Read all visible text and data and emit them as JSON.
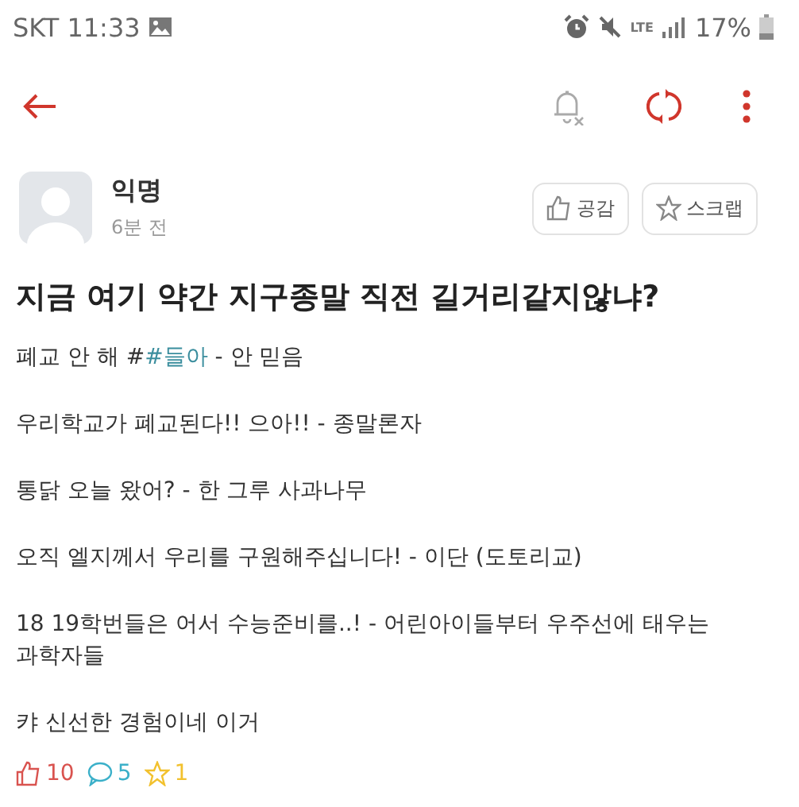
{
  "status_bar": {
    "carrier": "SKT",
    "time": "11:33",
    "network": "LTE",
    "battery": "17%"
  },
  "post": {
    "author": "익명",
    "time": "6분 전",
    "actions": [
      {
        "kind": "like",
        "label": "공감"
      },
      {
        "kind": "scrap",
        "label": "스크랩"
      }
    ],
    "title": "지금 여기 약간 지구종말 직전 길거리같지않냐?",
    "paragraphs": [
      {
        "parts": [
          {
            "kind": "text",
            "text": "폐교 안 해 #"
          },
          {
            "kind": "hashtag",
            "text": "#들아"
          },
          {
            "kind": "text",
            "text": " - 안 믿음"
          }
        ]
      },
      {
        "parts": [
          {
            "kind": "text",
            "text": "우리학교가 폐교된다!! 으아!! - 종말론자"
          }
        ]
      },
      {
        "parts": [
          {
            "kind": "text",
            "text": "통닭 오늘 왔어? - 한 그루 사과나무"
          }
        ]
      },
      {
        "parts": [
          {
            "kind": "text",
            "text": "오직 엘지께서 우리를 구원해주십니다! - 이단 (도토리교)"
          }
        ]
      },
      {
        "parts": [
          {
            "kind": "text",
            "text": "18 19학번들은 어서 수능준비를..! - 어린아이들부터 우주선에 태우는 과학자들"
          }
        ]
      },
      {
        "parts": [
          {
            "kind": "text",
            "text": "캬 신선한 경험이네 이거"
          }
        ]
      }
    ],
    "stats": [
      {
        "kind": "likes",
        "count": "10",
        "color": "#d9534f"
      },
      {
        "kind": "comments",
        "count": "5",
        "color": "#3bb0c9"
      },
      {
        "kind": "scraps",
        "count": "1",
        "color": "#f2c12e"
      }
    ]
  }
}
